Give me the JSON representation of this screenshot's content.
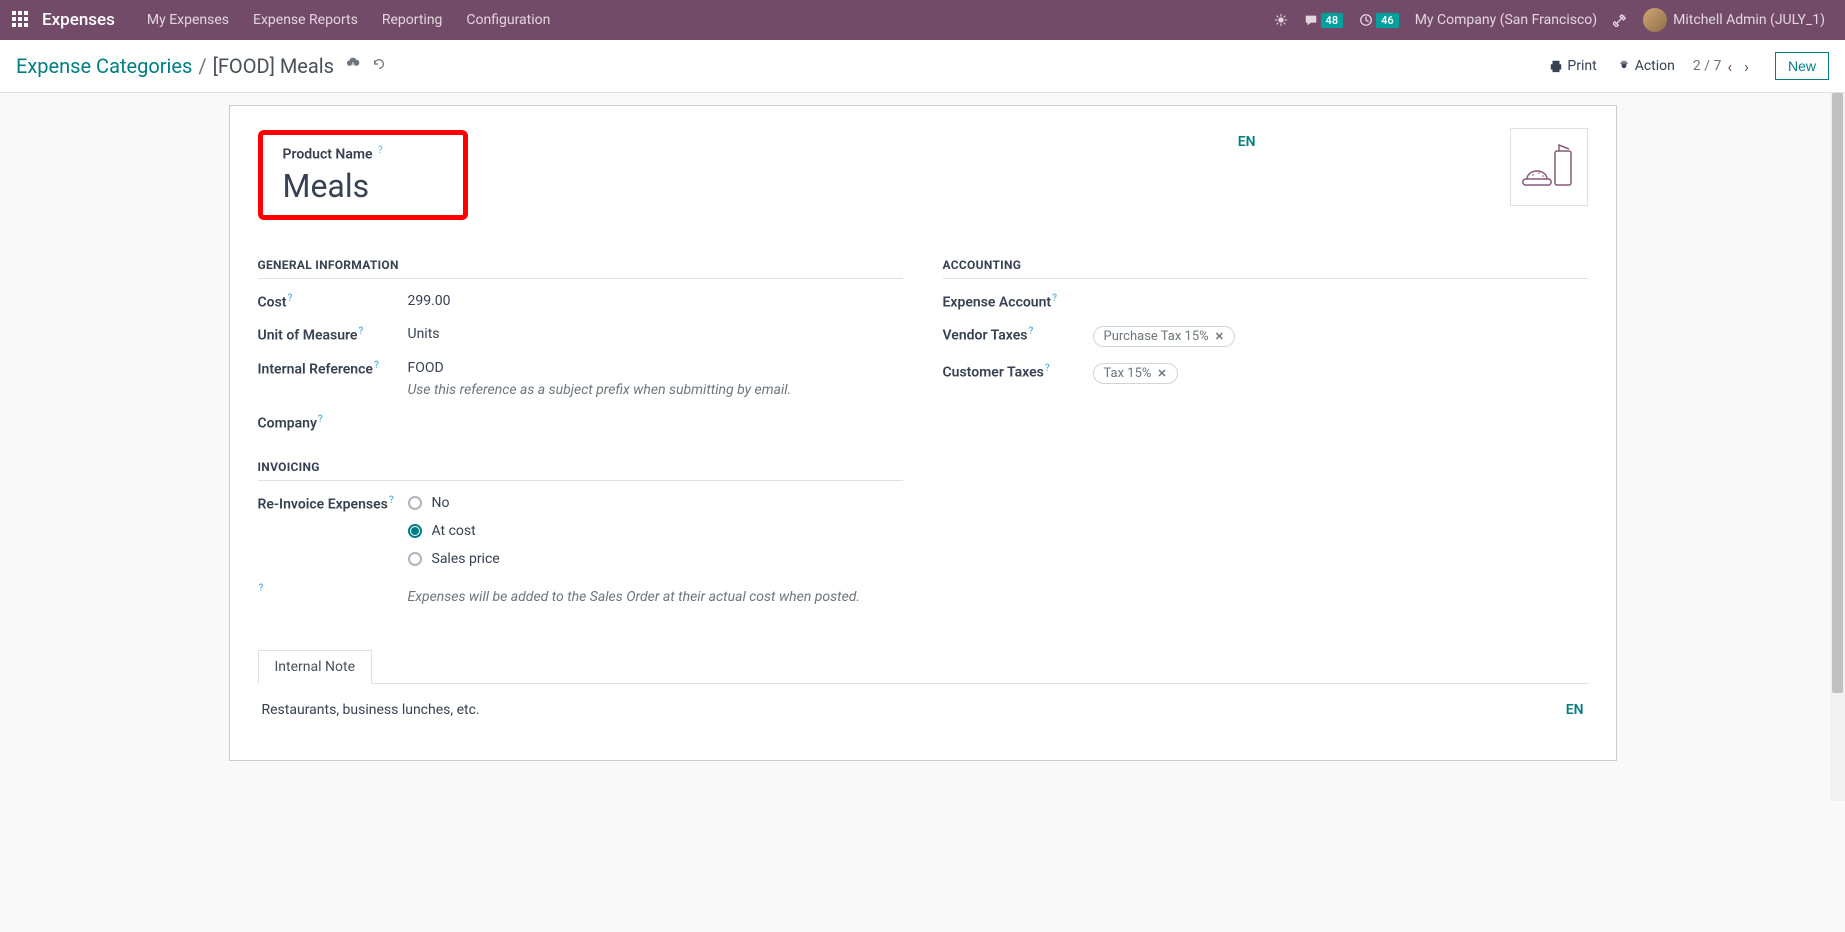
{
  "topnav": {
    "brand": "Expenses",
    "items": [
      "My Expenses",
      "Expense Reports",
      "Reporting",
      "Configuration"
    ],
    "chat_badge": "48",
    "activity_badge": "46",
    "company": "My Company (San Francisco)",
    "user": "Mitchell Admin (JULY_1)"
  },
  "controlbar": {
    "breadcrumb_root": "Expense Categories",
    "breadcrumb_current": "[FOOD] Meals",
    "print": "Print",
    "action": "Action",
    "pager": "2 / 7",
    "new": "New"
  },
  "form": {
    "product_name_label": "Product Name",
    "product_name_value": "Meals",
    "lang_pill": "EN",
    "sections": {
      "general": "GENERAL INFORMATION",
      "accounting": "ACCOUNTING",
      "invoicing": "INVOICING"
    },
    "general": {
      "cost_label": "Cost",
      "cost_value": "299.00",
      "uom_label": "Unit of Measure",
      "uom_value": "Units",
      "ref_label": "Internal Reference",
      "ref_value": "FOOD",
      "ref_hint": "Use this reference as a subject prefix when submitting by email.",
      "company_label": "Company"
    },
    "accounting": {
      "exp_acc_label": "Expense Account",
      "vendor_tax_label": "Vendor Taxes",
      "vendor_tax_tag": "Purchase Tax 15%",
      "cust_tax_label": "Customer Taxes",
      "cust_tax_tag": "Tax 15%"
    },
    "invoicing": {
      "reinv_label": "Re-Invoice Expenses",
      "opt_no": "No",
      "opt_cost": "At cost",
      "opt_sales": "Sales price",
      "hint": "Expenses will be added to the Sales Order at their actual cost when posted."
    },
    "tabs": {
      "internal_note": "Internal Note",
      "note_text": "Restaurants, business lunches, etc.",
      "lang": "EN"
    }
  }
}
